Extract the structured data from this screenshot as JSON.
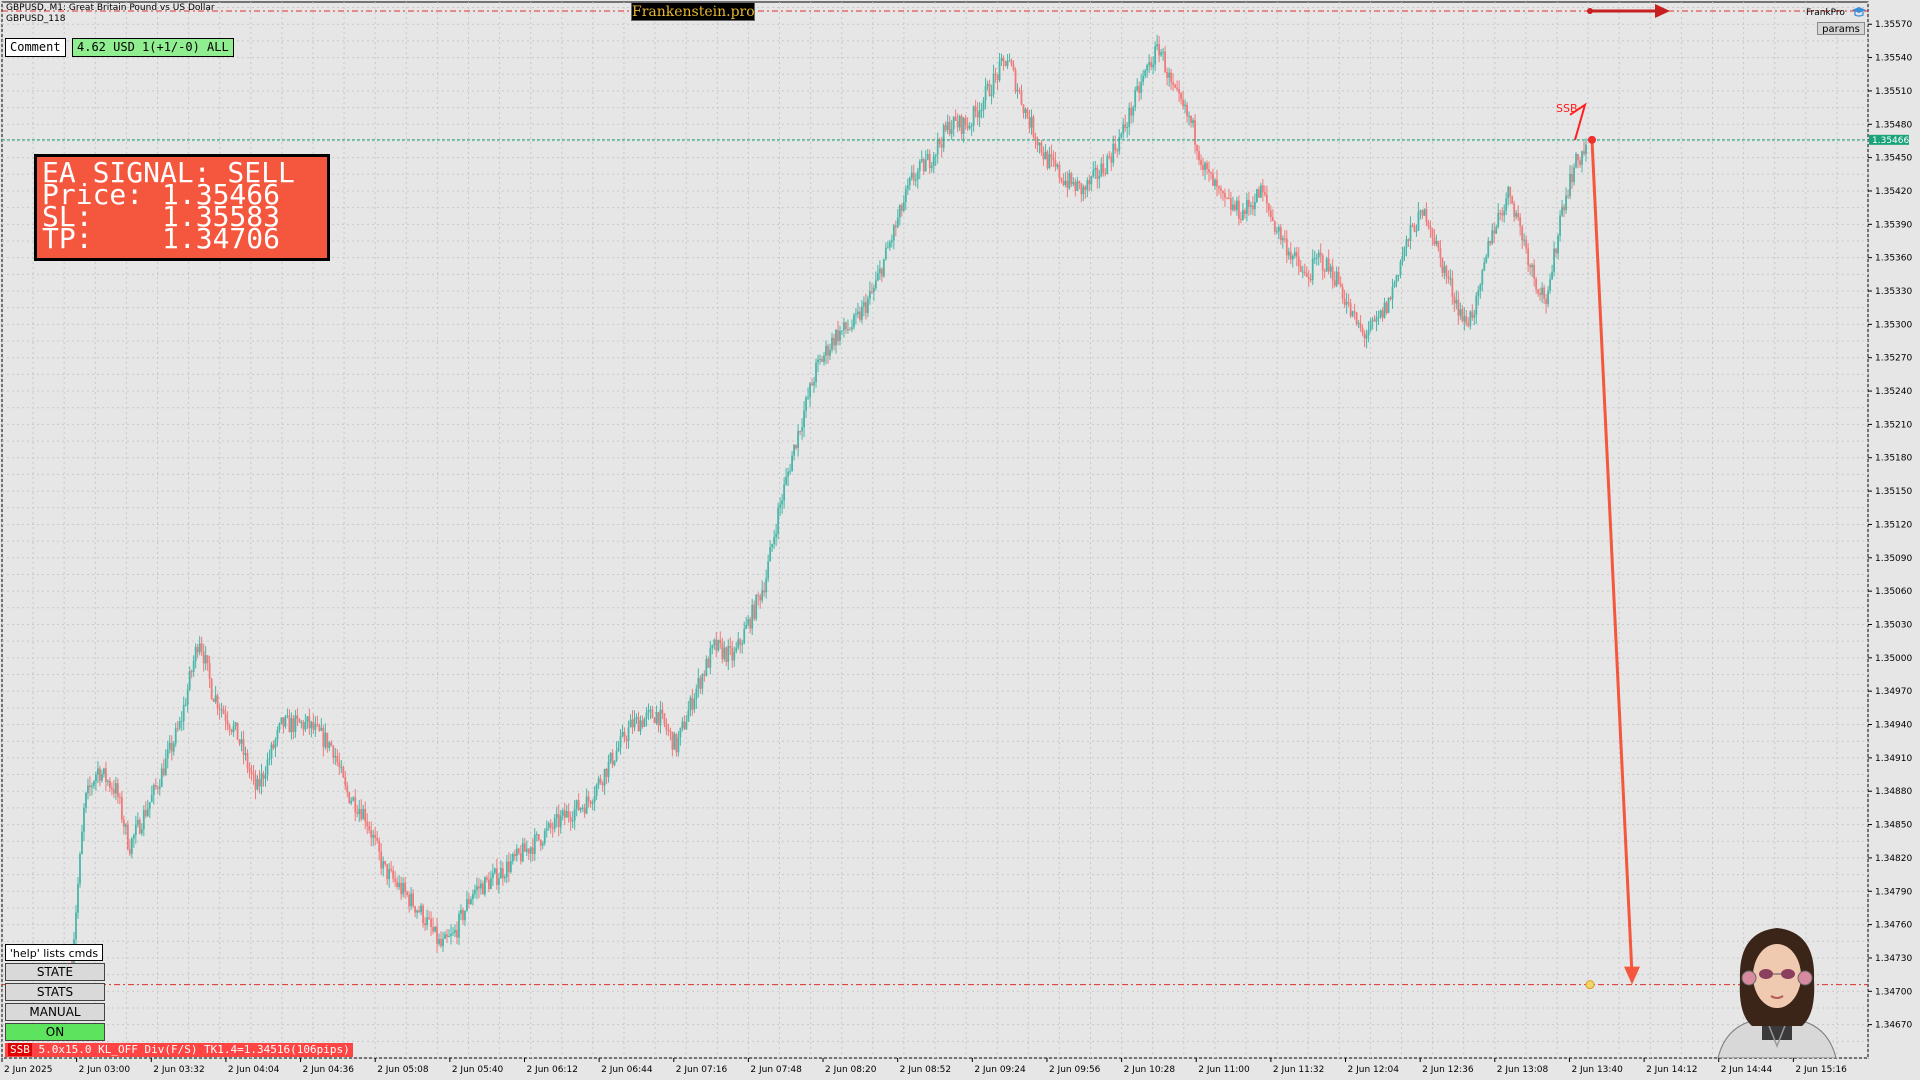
{
  "header": {
    "line1": "GBPUSD, M1:  Great Britain Pound vs US Dollar",
    "line2": "GBPUSD_118"
  },
  "brand_badge": "Frankenstein.pro",
  "comment_button": "Comment",
  "pnl_box": "4.62 USD 1(+1/-0) ALL",
  "signal": {
    "title": "EA SIGNAL: SELL",
    "rows": [
      {
        "label": "Price:",
        "value": "1.35466"
      },
      {
        "label": "SL:",
        "value": "1.35583"
      },
      {
        "label": "TP:",
        "value": "1.34706"
      }
    ]
  },
  "brand_right": "FrankPro",
  "params_button": "params",
  "help_text": "'help' lists cmds",
  "commands": [
    "STATE",
    "STATS",
    "MANUAL",
    "ON"
  ],
  "status_bar": {
    "prefix": "SSB",
    "text": " 5.0x15.0 KL_OFF Div(F/S) TK1.4=1.34516(106pips)"
  },
  "ssb_label": "SSB",
  "colors": {
    "bull": "#48b6a8",
    "bear": "#ef7a7a",
    "grid": "#c9c9c9",
    "bid_line": "#1aa37a",
    "stop_line": "#e03030",
    "target_arrow": "#f4573d"
  },
  "chart_data": {
    "type": "candlestick",
    "symbol": "GBPUSD",
    "timeframe": "M1",
    "current_price": "1.35466",
    "y_ticks": [
      "1.35570",
      "1.35540",
      "1.35510",
      "1.35480",
      "1.35450",
      "1.35420",
      "1.35390",
      "1.35360",
      "1.35330",
      "1.35300",
      "1.35270",
      "1.35240",
      "1.35210",
      "1.35180",
      "1.35150",
      "1.35120",
      "1.35090",
      "1.35060",
      "1.35030",
      "1.35000",
      "1.34970",
      "1.34940",
      "1.34910",
      "1.34880",
      "1.34850",
      "1.34820",
      "1.34790",
      "1.34760",
      "1.34730",
      "1.34700",
      "1.34670"
    ],
    "ylim": [
      1.3464,
      1.3559
    ],
    "x_ticks": [
      "2 Jun 2025",
      "2 Jun 03:00",
      "2 Jun 03:32",
      "2 Jun 04:04",
      "2 Jun 04:36",
      "2 Jun 05:08",
      "2 Jun 05:40",
      "2 Jun 06:12",
      "2 Jun 06:44",
      "2 Jun 07:16",
      "2 Jun 07:48",
      "2 Jun 08:20",
      "2 Jun 08:52",
      "2 Jun 09:24",
      "2 Jun 09:56",
      "2 Jun 10:28",
      "2 Jun 11:00",
      "2 Jun 11:32",
      "2 Jun 12:04",
      "2 Jun 12:36",
      "2 Jun 13:08",
      "2 Jun 13:40",
      "2 Jun 14:12",
      "2 Jun 14:44",
      "2 Jun 15:16"
    ],
    "price_path": [
      [
        0,
        1.3473
      ],
      [
        4,
        1.3487
      ],
      [
        8,
        1.349
      ],
      [
        14,
        1.3488
      ],
      [
        18,
        1.3483
      ],
      [
        26,
        1.3488
      ],
      [
        34,
        1.3494
      ],
      [
        40,
        1.3502
      ],
      [
        44,
        1.3497
      ],
      [
        52,
        1.3493
      ],
      [
        58,
        1.3488
      ],
      [
        66,
        1.3494
      ],
      [
        74,
        1.3494
      ],
      [
        82,
        1.3492
      ],
      [
        86,
        1.3488
      ],
      [
        92,
        1.3486
      ],
      [
        98,
        1.3481
      ],
      [
        104,
        1.3479
      ],
      [
        110,
        1.3477
      ],
      [
        116,
        1.3474
      ],
      [
        120,
        1.3475
      ],
      [
        126,
        1.3479
      ],
      [
        132,
        1.348
      ],
      [
        140,
        1.3482
      ],
      [
        148,
        1.3484
      ],
      [
        156,
        1.3486
      ],
      [
        162,
        1.3487
      ],
      [
        170,
        1.3491
      ],
      [
        176,
        1.3494
      ],
      [
        184,
        1.3495
      ],
      [
        190,
        1.3492
      ],
      [
        196,
        1.3497
      ],
      [
        202,
        1.3501
      ],
      [
        208,
        1.35
      ],
      [
        214,
        1.3504
      ],
      [
        218,
        1.3507
      ],
      [
        222,
        1.3513
      ],
      [
        228,
        1.352
      ],
      [
        234,
        1.3526
      ],
      [
        240,
        1.3529
      ],
      [
        246,
        1.353
      ],
      [
        252,
        1.3533
      ],
      [
        258,
        1.3538
      ],
      [
        264,
        1.3543
      ],
      [
        270,
        1.3545
      ],
      [
        276,
        1.3548
      ],
      [
        282,
        1.3548
      ],
      [
        288,
        1.3551
      ],
      [
        294,
        1.3554
      ],
      [
        300,
        1.3549
      ],
      [
        306,
        1.3545
      ],
      [
        312,
        1.3543
      ],
      [
        318,
        1.3542
      ],
      [
        324,
        1.3544
      ],
      [
        330,
        1.3547
      ],
      [
        334,
        1.355
      ],
      [
        338,
        1.3553
      ],
      [
        342,
        1.3555
      ],
      [
        346,
        1.3551
      ],
      [
        352,
        1.3548
      ],
      [
        356,
        1.3544
      ],
      [
        362,
        1.3541
      ],
      [
        368,
        1.354
      ],
      [
        374,
        1.3542
      ],
      [
        378,
        1.3539
      ],
      [
        384,
        1.3536
      ],
      [
        388,
        1.3534
      ],
      [
        392,
        1.3536
      ],
      [
        398,
        1.3534
      ],
      [
        402,
        1.3531
      ],
      [
        406,
        1.3529
      ],
      [
        410,
        1.353
      ],
      [
        414,
        1.3532
      ],
      [
        418,
        1.3536
      ],
      [
        422,
        1.3539
      ],
      [
        426,
        1.354
      ],
      [
        430,
        1.3536
      ],
      [
        434,
        1.3533
      ],
      [
        438,
        1.353
      ],
      [
        442,
        1.3532
      ],
      [
        446,
        1.3538
      ],
      [
        452,
        1.3542
      ],
      [
        456,
        1.3538
      ],
      [
        460,
        1.3534
      ],
      [
        464,
        1.3532
      ],
      [
        468,
        1.354
      ],
      [
        472,
        1.3544
      ],
      [
        476,
        1.3546
      ]
    ],
    "markers": {
      "bid_price": "1.35466",
      "target_price": "1.34706",
      "signal": "SELL"
    }
  }
}
